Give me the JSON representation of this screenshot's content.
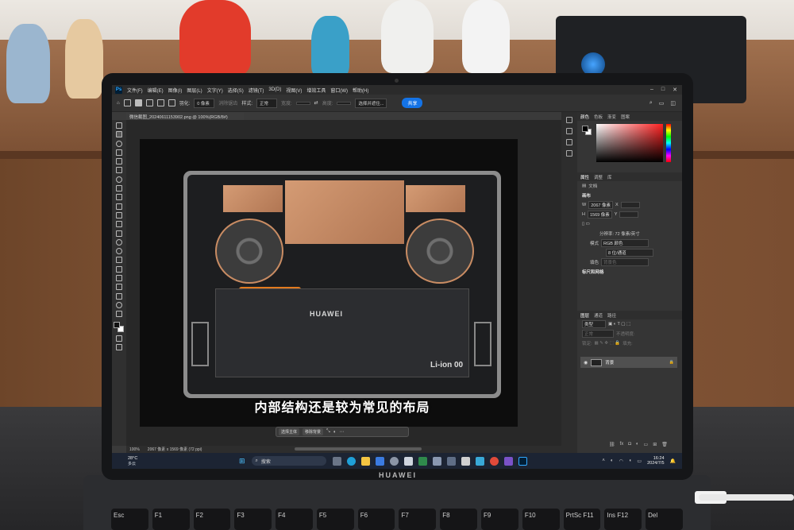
{
  "scene": {
    "laptop_brand": "HUAWEI",
    "keys": [
      "Esc",
      "F1",
      "F2",
      "F3",
      "F4",
      "F5",
      "F6",
      "F7",
      "F8",
      "F9",
      "F10",
      "PrtSc\nF11",
      "Ins\nF12",
      "Del"
    ]
  },
  "app": {
    "logo": "Ps",
    "menu": [
      "文件(F)",
      "编辑(E)",
      "图像(I)",
      "图层(L)",
      "文字(Y)",
      "选择(S)",
      "滤镜(T)",
      "3D(D)",
      "视图(V)",
      "增效工具",
      "窗口(W)",
      "帮助(H)"
    ],
    "window_controls": [
      "–",
      "□",
      "✕"
    ]
  },
  "options": {
    "feather_label": "羽化:",
    "feather_value": "0 像素",
    "antialias_label": "消除锯齿",
    "style_label": "样式:",
    "style_value": "正常",
    "width_label": "宽度:",
    "height_label": "高度:",
    "select_subject": "选择并遮住...",
    "share": "共享"
  },
  "document": {
    "tab_title": "微信截图_20240611153902.png @ 100%(RGB/8#)",
    "status_zoom": "100%",
    "status_size": "2067 像素 x 1569 像素 (72 ppi)"
  },
  "image_content": {
    "battery_brand": "HUAWEI",
    "battery_type": "Li-ion 00",
    "caption": "内部结构还是较为常见的布局"
  },
  "context_bar": {
    "select_subject": "选择主体",
    "remove_bg": "移除背景",
    "more": "⋯"
  },
  "panels": {
    "color_tabs": [
      "颜色",
      "色板",
      "渐变",
      "图案"
    ],
    "props_tabs": [
      "属性",
      "调整",
      "库"
    ],
    "doc_label": "文档",
    "canvas_section": "画布",
    "w_label": "W",
    "w_value": "2067 像素",
    "h_label": "H",
    "h_value": "1569 像素",
    "x_label": "X",
    "y_label": "Y",
    "resolution": "分辨率: 72 像素/英寸",
    "mode_label": "模式",
    "mode_value": "RGB 颜色",
    "depth_value": "8 位/通道",
    "fill_label": "填色",
    "fill_value": "背景色",
    "rulers_section": "标尺和网格",
    "layers_tabs": [
      "图层",
      "通道",
      "路径"
    ],
    "layer_kind": "类型",
    "blend_mode": "正常",
    "opacity_label": "不透明度:",
    "lock_label": "锁定:",
    "fill_pct_label": "填充:",
    "layer_name": "背景"
  },
  "taskbar": {
    "weather_temp": "28°C",
    "weather_desc": "多云",
    "search": "搜索",
    "time": "16:24",
    "date": "2024/7/5"
  },
  "colors": {
    "ps_blue": "#31a8ff",
    "share_blue": "#1473e6",
    "ribbon_orange": "#e27a1f"
  }
}
